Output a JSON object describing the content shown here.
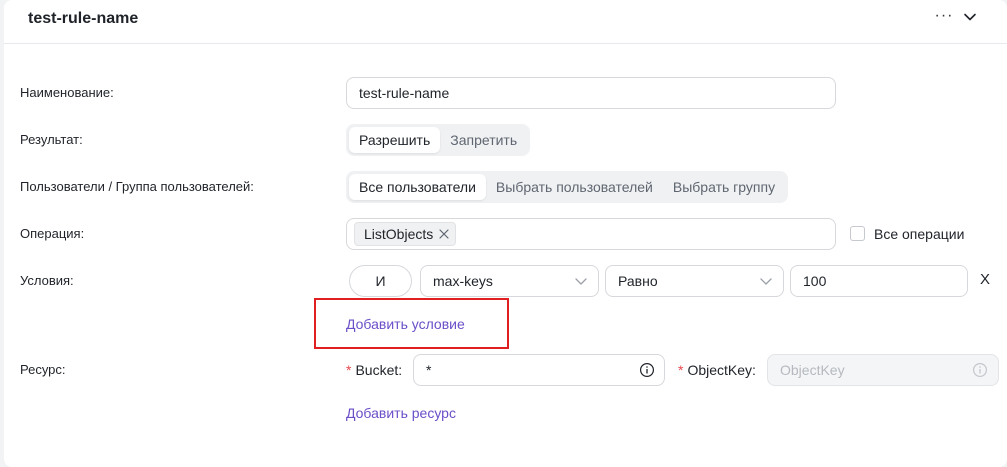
{
  "header": {
    "title": "test-rule-name",
    "more_label": "···"
  },
  "form": {
    "name": {
      "label": "Наименование:",
      "value": "test-rule-name"
    },
    "result": {
      "label": "Результат:",
      "options": [
        "Разрешить",
        "Запретить"
      ],
      "selected": "Разрешить"
    },
    "users": {
      "label": "Пользователи / Группа пользователей:",
      "options": [
        "Все пользователи",
        "Выбрать пользователей",
        "Выбрать группу"
      ],
      "selected": "Все пользователи"
    },
    "operation": {
      "label": "Операция:",
      "tags": [
        "ListObjects"
      ],
      "all_operations_label": "Все операции",
      "all_operations_checked": false
    },
    "conditions": {
      "label": "Условия:",
      "logic": "И",
      "key": "max-keys",
      "operator": "Равно",
      "value": "100",
      "remove_label": "X",
      "add_label": "Добавить условие"
    },
    "resource": {
      "label": "Ресурс:",
      "bucket_label": "Bucket:",
      "bucket_value": "*",
      "object_key_label": "ObjectKey:",
      "object_key_placeholder": "ObjectKey",
      "add_label": "Добавить ресурс"
    }
  },
  "colors": {
    "accent": "#6a4fc8",
    "required": "#e5484d",
    "highlight": "#e02020"
  },
  "icons": {
    "more": "more-horizontal-icon",
    "collapse": "chevron-down-icon",
    "tag_remove": "close-icon",
    "select": "chevron-down-icon",
    "info": "info-circle-icon"
  }
}
